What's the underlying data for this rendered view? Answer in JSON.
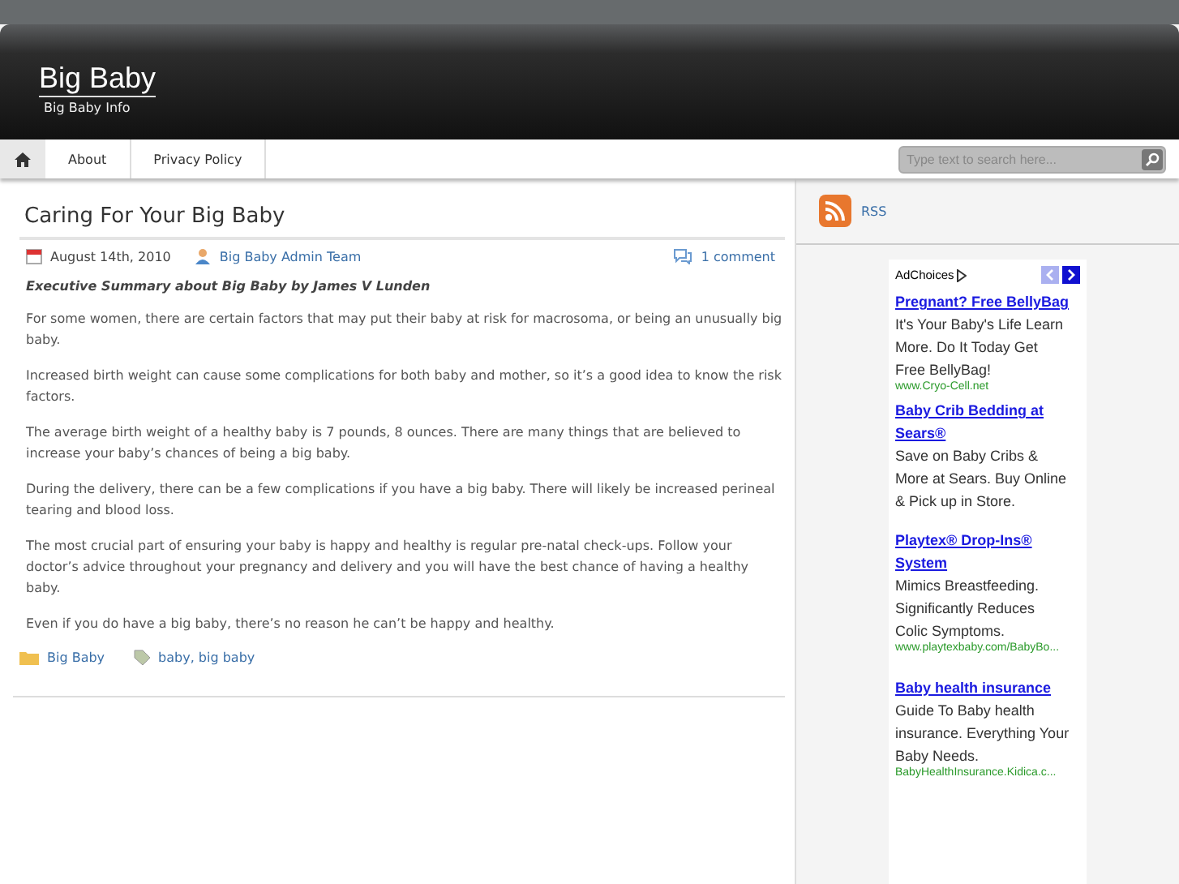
{
  "site": {
    "title": "Big Baby",
    "tagline": "Big Baby Info"
  },
  "nav": {
    "items": [
      {
        "label": "About",
        "selected": false
      },
      {
        "label": "Privacy Policy",
        "selected": false
      }
    ],
    "search": {
      "placeholder": "Type text to search here..."
    }
  },
  "post": {
    "title": "Caring For Your Big Baby",
    "date": "August 14th, 2010",
    "author": "Big Baby Admin Team",
    "comments": "1 comment",
    "summary": "Executive Summary about Big Baby by James V Lunden",
    "paragraphs": [
      "For some women, there are certain factors that may put their baby at risk for macrosoma, or being an unusually big baby.",
      "Increased birth weight can cause some complications for both baby and mother, so it’s a good idea to know the risk factors.",
      "The average birth weight of a healthy baby is 7 pounds, 8 ounces. There are many things that are believed to increase your baby’s chances of being a big baby.",
      "During the delivery, there can be a few complications if you have a big baby. There will likely be increased perineal tearing and blood loss.",
      "The most crucial part of ensuring your baby is happy and healthy is regular pre-natal check-ups. Follow your doctor’s advice throughout your pregnancy and delivery and you will have the best chance of having a healthy baby.",
      "Even if you do have a big baby, there’s no reason he can’t be happy and healthy."
    ],
    "category": "Big Baby",
    "tags": "baby, big baby"
  },
  "sidebar": {
    "rss": "RSS",
    "ad_label": "AdChoices",
    "ads": [
      {
        "title": "Pregnant? Free BellyBag",
        "text": "It's Your Baby's Life Learn More. Do It Today Get Free BellyBag!",
        "url": "www.Cryo-Cell.net"
      },
      {
        "title": "Baby Crib Bedding at Sears®",
        "text": "Save on Baby Cribs & More at Sears. Buy Online & Pick up in Store."
      },
      {
        "title": "Playtex® Drop-Ins® System",
        "text": "Mimics Breastfeeding. Significantly Reduces Colic Symptoms.",
        "url": "www.playtexbaby.com/BabyBo..."
      },
      {
        "title": "Baby health insurance",
        "text": "Guide To Baby health insurance. Everything Your Baby Needs.",
        "url": "BabyHealthInsurance.Kidica.c..."
      }
    ]
  }
}
